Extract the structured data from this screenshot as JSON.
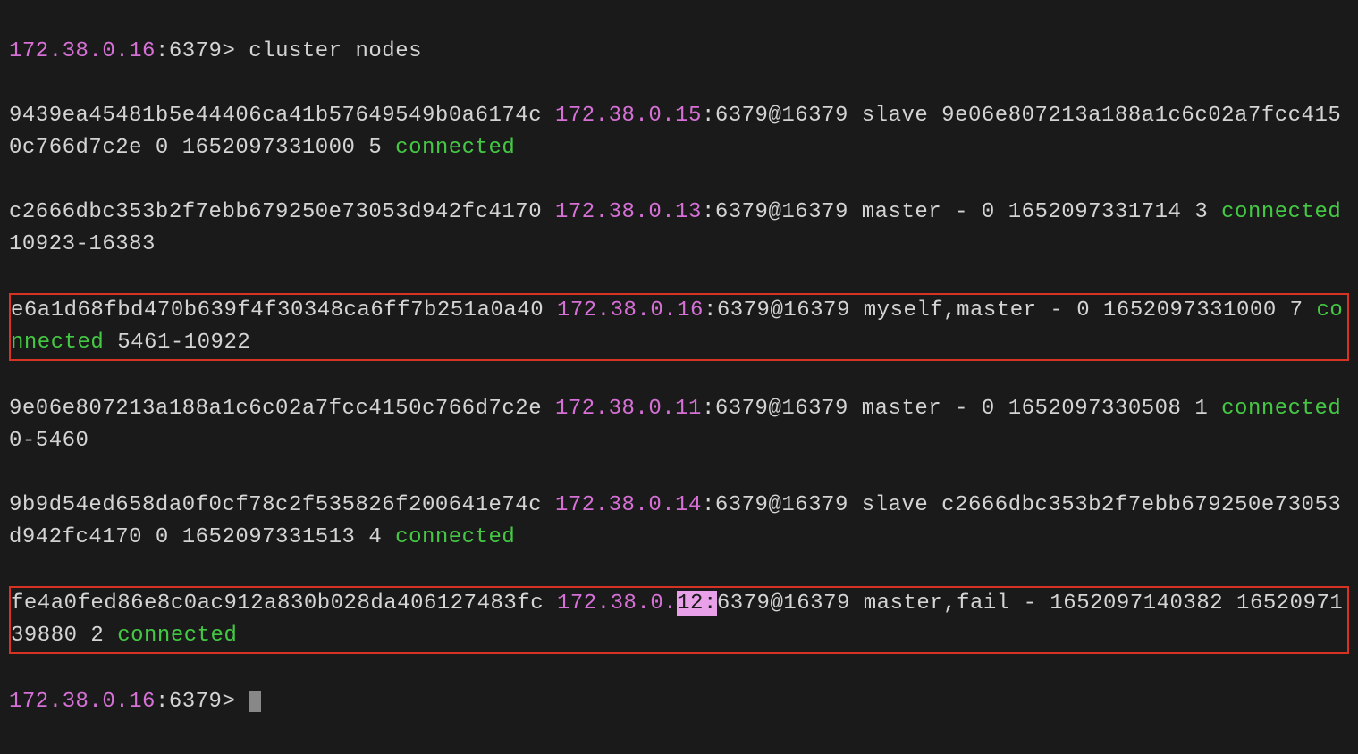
{
  "prompt": {
    "ip": "172.38.0.16",
    "port": ":6379> ",
    "command": "cluster nodes"
  },
  "nodes": {
    "node1": {
      "id": "9439ea45481b5e44406ca41b57649549b0a6174c ",
      "ip": "172.38.0.15",
      "addr": ":6379@16379 slave 9e06e807213a188a1c6c02a7fcc4150c766d7c2e 0 1652097331000 5 ",
      "status": "connected"
    },
    "node2": {
      "id": "c2666dbc353b2f7ebb679250e73053d942fc4170 ",
      "ip": "172.38.0.13",
      "addr": ":6379@16379 master - 0 1652097331714 3 ",
      "status": "connected",
      "slots": " 10923-16383"
    },
    "node3": {
      "id": "e6a1d68fbd470b639f4f30348ca6ff7b251a0a40 ",
      "ip": "172.38.0.16",
      "addr": ":6379@16379 myself,master - 0 1652097331000 7 ",
      "status": "connected",
      "slots": " 5461-10922"
    },
    "node4": {
      "id": "9e06e807213a188a1c6c02a7fcc4150c766d7c2e ",
      "ip": "172.38.0.11",
      "addr": ":6379@16379 master - 0 1652097330508 1 ",
      "status": "connected",
      "slots": " 0-5460"
    },
    "node5": {
      "id": "9b9d54ed658da0f0cf78c2f535826f200641e74c ",
      "ip": "172.38.0.14",
      "addr": ":6379@16379 slave c2666dbc353b2f7ebb679250e73053d942fc4170 0 1652097331513 4 ",
      "status": "connected"
    },
    "node6": {
      "id_part1": "fe4a0fed86e8c0ac912a830b028da406127483fc ",
      "ip_part1": "172.38.0.",
      "ip_sel": "12",
      "ip_colon": ":",
      "addr": "6379@16379 master,fail - 1652097140382 1652097139880 2 ",
      "status": "connected"
    }
  },
  "prompt2": {
    "ip": "172.38.0.16",
    "port": ":6379> "
  }
}
